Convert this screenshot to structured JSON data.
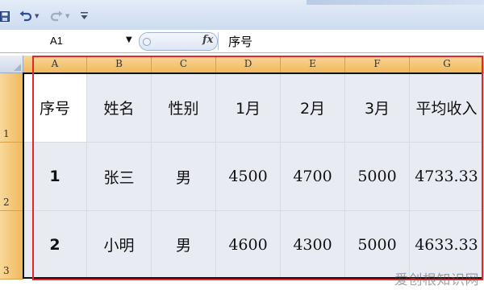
{
  "toolbar": {
    "save_icon": "save-icon",
    "undo_icon": "undo-icon",
    "redo_icon": "redo-icon",
    "customize_icon": "customize-qat-icon"
  },
  "formula_bar": {
    "name_box": "A1",
    "fx_label": "fx",
    "formula": "序号"
  },
  "sheet": {
    "columns": [
      "A",
      "B",
      "C",
      "D",
      "E",
      "F",
      "G"
    ],
    "rows": [
      "1",
      "2",
      "3"
    ],
    "cells": [
      [
        "序号",
        "姓名",
        "性别",
        "1月",
        "2月",
        "3月",
        "平均收入"
      ],
      [
        "1",
        "张三",
        "男",
        "4500",
        "4700",
        "5000",
        "4733.33"
      ],
      [
        "2",
        "小明",
        "男",
        "4600",
        "4300",
        "5000",
        "4633.33"
      ]
    ]
  },
  "colors": {
    "highlight_box": "#e2262a",
    "header_orange": "#f1b85c",
    "cell_fill": "#e9ebf3"
  },
  "watermark": "爱创根知识网"
}
